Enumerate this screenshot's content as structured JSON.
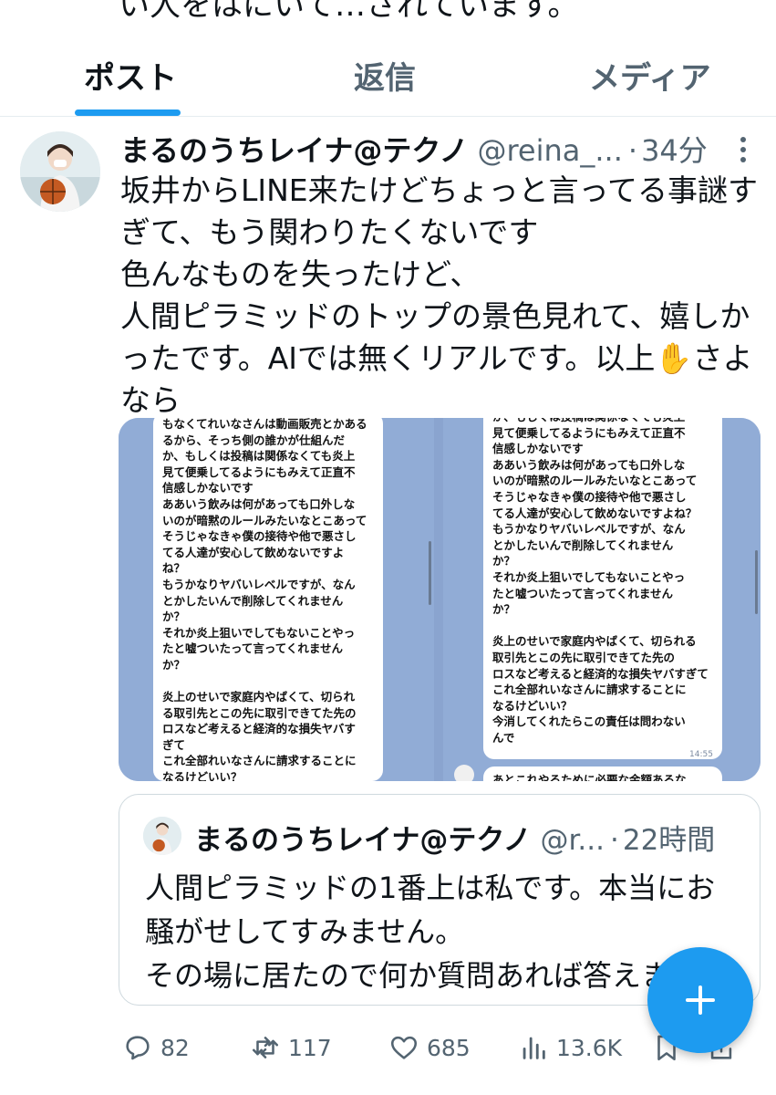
{
  "top_partial_text": "い人をはにいて…されています。",
  "tabs": [
    {
      "label": "ポスト",
      "active": true
    },
    {
      "label": "返信",
      "active": false
    },
    {
      "label": "メディア",
      "active": false
    }
  ],
  "post": {
    "author": "まるのうちレイナ@テクノ",
    "handle": "@reina_...",
    "separator": "·",
    "time": "34分",
    "text_lines": [
      "坂井からLINE来たけどちょっと言ってる事謎す",
      "ぎて、もう関わりたくないです",
      "色んなものを失ったけど、",
      "人間ピラミッドのトップの景色見れて、嬉しか",
      "ったです。AIでは無くリアルです。以上✋さよ",
      "なら"
    ]
  },
  "media": {
    "left_lines": [
      "もなくてれいなさんは動画販売とかある",
      "るから、そっち側の誰かが仕組んだ",
      "か、もしくは投稿は関係なくても炎上",
      "見て便乗してるようにもみえて正直不",
      "信感しかないです",
      "ああいう飲みは何があっても口外しな",
      "いのが暗黙のルールみたいなとこあって",
      "そうじゃなきゃ僕の接待や他で悪さし",
      "てる人達が安心して飲めないですよ",
      "ね？",
      "もうかなりヤバいレベルですが、なん",
      "とかしたいんで削除してくれません",
      "か？",
      "それか炎上狙いでしてもないことやっ",
      "たと嘘ついたって言ってくれません",
      "か？",
      "",
      "炎上のせいで家庭内やばくて、切られ",
      "る取引先とこの先に取引できてた先の",
      "ロスなど考えると経済的な損失ヤバす",
      "ぎて",
      "これ全部れいなさんに請求することに",
      "なるけどいい？",
      "今消してくれたらこの責任は問わない",
      "んで"
    ],
    "right_lines": [
      "か、もしくは投稿は関係なくても炎上",
      "見て便乗してるようにもみえて正直不",
      "信感しかないです",
      "ああいう飲みは何があっても口外しな",
      "いのが暗黙のルールみたいなとこあって",
      "そうじゃなきゃ僕の接待や他で悪さし",
      "てる人達が安心して飲めないですよね？",
      "もうかなりヤバいレベルですが、なん",
      "とかしたいんで削除してくれません",
      "か？",
      "それか炎上狙いでしてもないことやっ",
      "たと嘘ついたって言ってくれません",
      "か？",
      "",
      "炎上のせいで家庭内やばくて、切られる",
      "取引先とこの先に取引できてた先の",
      "ロスなど考えると経済的な損失ヤバすぎて",
      "これ全部れいなさんに請求することに",
      "なるけどいい？",
      "今消してくれたらこの責任は問わない",
      "んで"
    ],
    "right_time": "14:55",
    "right_bottom_line": "あとこれやるために必要な金額あるな"
  },
  "quote": {
    "author": "まるのうちレイナ@テクノ",
    "handle": "@r...",
    "separator": "·",
    "time": "22時間",
    "text_lines": [
      "人間ピラミッドの1番上は私です。本当にお",
      "騒がせしてすみません。",
      "その場に居たので何か質問あれば答えます"
    ]
  },
  "actions": {
    "replies": "82",
    "reposts": "117",
    "likes": "685",
    "views": "13.6K"
  },
  "colors": {
    "accent": "#1d9bf0",
    "text_primary": "#0f1419",
    "text_secondary": "#536471",
    "border": "#cfd9de",
    "chat_background": "#91acd6"
  },
  "icons": [
    "more-icon",
    "reply-icon",
    "repost-icon",
    "like-icon",
    "views-icon",
    "bookmark-icon",
    "share-icon",
    "compose-plus-icon"
  ]
}
